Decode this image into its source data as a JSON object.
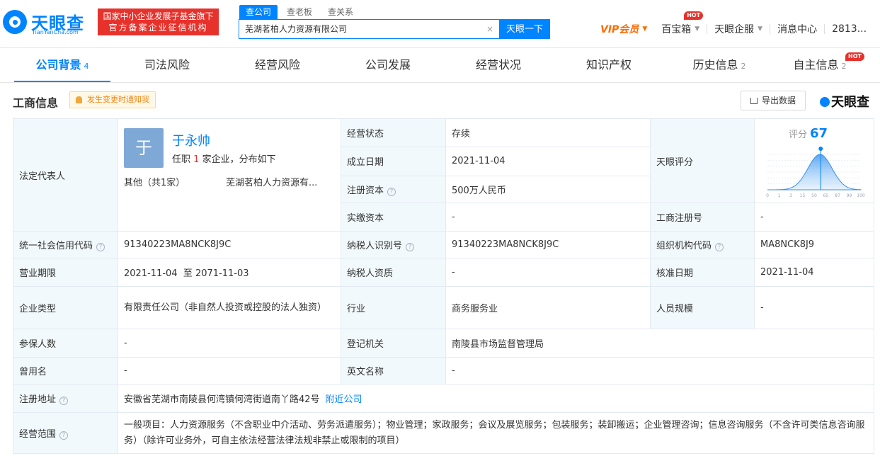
{
  "header": {
    "logo_cn": "天眼查",
    "logo_en": "TianYanCha.com",
    "promo_line1": "国家中小企业发展子基金旗下",
    "promo_line2": "官方备案企业征信机构",
    "search_tabs": [
      {
        "label": "查公司",
        "active": true
      },
      {
        "label": "查老板",
        "active": false
      },
      {
        "label": "查关系",
        "active": false
      }
    ],
    "search_value": "芜湖茗柏人力资源有限公司",
    "search_clear": "×",
    "search_button": "天眼一下",
    "nav": {
      "vip": "VIP会员",
      "treasure": "百宝箱",
      "hot": "HOT",
      "enterprise": "天眼企服",
      "messages": "消息中心",
      "user": "2813..."
    }
  },
  "tabs": [
    {
      "label": "公司背景",
      "count": "4",
      "active": true
    },
    {
      "label": "司法风险",
      "count": "",
      "active": false
    },
    {
      "label": "经营风险",
      "count": "",
      "active": false
    },
    {
      "label": "公司发展",
      "count": "",
      "active": false
    },
    {
      "label": "经营状况",
      "count": "",
      "active": false
    },
    {
      "label": "知识产权",
      "count": "",
      "active": false
    },
    {
      "label": "历史信息",
      "count": "2",
      "active": false
    },
    {
      "label": "自主信息",
      "count": "2",
      "active": false,
      "hot": "HOT"
    }
  ],
  "section": {
    "title": "工商信息",
    "notify": "发生变更时通知我",
    "export": "导出数据",
    "brand": "天眼查"
  },
  "legal": {
    "label": "法定代表人",
    "avatar": "于",
    "name": "于永帅",
    "info_prefix": "任职",
    "info_count": "1",
    "info_suffix": "家企业，分布如下",
    "other": "其他（共1家）",
    "company": "芜湖茗柏人力资源有..."
  },
  "fields": {
    "status_label": "经营状态",
    "status": "存续",
    "founded_label": "成立日期",
    "founded": "2021-11-04",
    "capital_label": "注册资本",
    "capital": "500万人民币",
    "paid_label": "实缴资本",
    "paid": "-",
    "score_label": "天眼评分",
    "score_prefix": "评分",
    "score": "67",
    "regno_label": "工商注册号",
    "regno": "-",
    "credit_label": "统一社会信用代码",
    "credit": "91340223MA8NCK8J9C",
    "taxid_label": "纳税人识别号",
    "taxid": "91340223MA8NCK8J9C",
    "org_label": "组织机构代码",
    "org": "MA8NCK8J9",
    "term_label": "营业期限",
    "term": "2021-11-04  至 2071-11-03",
    "taxq_label": "纳税人资质",
    "taxq": "-",
    "approve_label": "核准日期",
    "approve": "2021-11-04",
    "type_label": "企业类型",
    "type": "有限责任公司（非自然人投资或控股的法人独资）",
    "industry_label": "行业",
    "industry": "商务服务业",
    "staff_label": "人员规模",
    "staff": "-",
    "insured_label": "参保人数",
    "insured": "-",
    "authority_label": "登记机关",
    "authority": "南陵县市场监督管理局",
    "former_label": "曾用名",
    "former": "-",
    "english_label": "英文名称",
    "english": "-",
    "address_label": "注册地址",
    "address": "安徽省芜湖市南陵县何湾镇何湾街道南丫路42号",
    "nearby": "附近公司",
    "scope_label": "经营范围",
    "scope": "一般项目：人力资源服务（不含职业中介活动、劳务派遣服务）；物业管理；家政服务；会议及展览服务；包装服务；装卸搬运；企业管理咨询；信息咨询服务（不含许可类信息咨询服务）（除许可业务外，可自主依法经营法律法规非禁止或限制的项目）"
  },
  "score_chart": {
    "ticks": [
      "0",
      "1",
      "3",
      "15",
      "50",
      "65",
      "87",
      "99",
      "100"
    ],
    "marker": 67,
    "color": "#0084ff"
  }
}
